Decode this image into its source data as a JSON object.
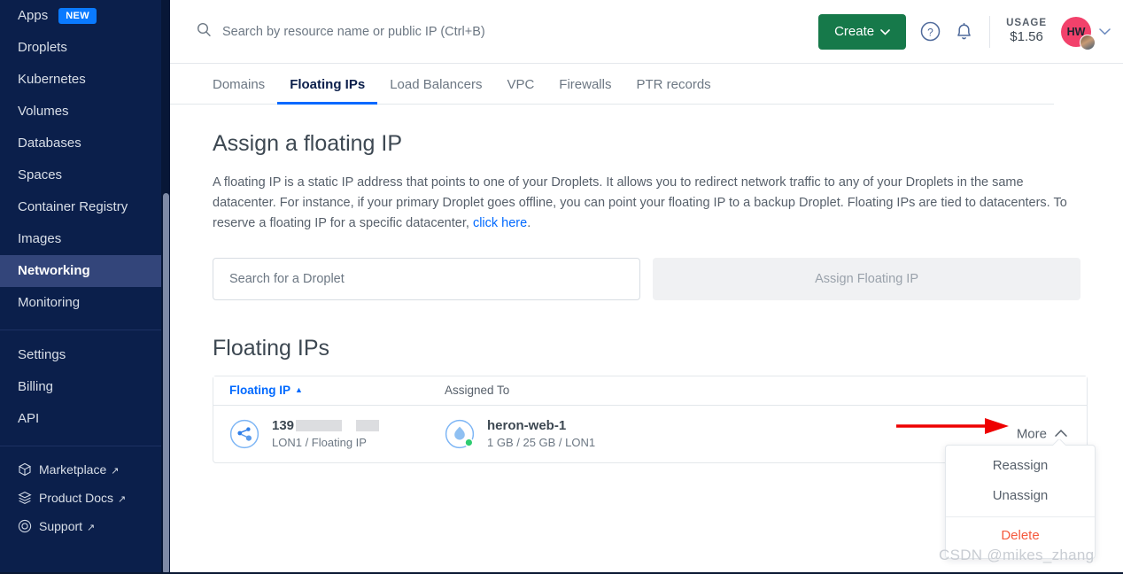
{
  "sidebar": {
    "items": [
      {
        "label": "Apps",
        "badge": "NEW",
        "active": false
      },
      {
        "label": "Droplets",
        "active": false
      },
      {
        "label": "Kubernetes",
        "active": false
      },
      {
        "label": "Volumes",
        "active": false
      },
      {
        "label": "Databases",
        "active": false
      },
      {
        "label": "Spaces",
        "active": false
      },
      {
        "label": "Container Registry",
        "active": false
      },
      {
        "label": "Images",
        "active": false
      },
      {
        "label": "Networking",
        "active": true
      },
      {
        "label": "Monitoring",
        "active": false
      }
    ],
    "account_items": [
      {
        "label": "Settings"
      },
      {
        "label": "Billing"
      },
      {
        "label": "API"
      }
    ],
    "external_items": [
      {
        "label": "Marketplace",
        "icon": "cube-icon",
        "arrow": "↗"
      },
      {
        "label": "Product Docs",
        "icon": "stack-icon",
        "arrow": "↗"
      },
      {
        "label": "Support",
        "icon": "lifering-icon",
        "arrow": "↗"
      }
    ],
    "colors": {
      "background": "#0b1f4b",
      "active_background": "#33457a",
      "badge": "#0a7aff"
    }
  },
  "header": {
    "search_placeholder": "Search by resource name or public IP (Ctrl+B)",
    "search_value": "",
    "create_label": "Create",
    "create_caret": "⌄",
    "help_icon": "help-circle-icon",
    "bell_icon": "notification-bell-icon",
    "usage_label": "USAGE",
    "usage_amount": "$1.56",
    "avatar_initials": "HW",
    "avatar_caret": "⌄",
    "colors": {
      "create_button": "#16794a",
      "avatar": "#f2416b"
    }
  },
  "tabs": [
    {
      "label": "Domains",
      "active": false
    },
    {
      "label": "Floating IPs",
      "active": true
    },
    {
      "label": "Load Balancers",
      "active": false
    },
    {
      "label": "VPC",
      "active": false
    },
    {
      "label": "Firewalls",
      "active": false
    },
    {
      "label": "PTR records",
      "active": false
    }
  ],
  "main": {
    "page_title": "Assign a floating IP",
    "description_part1": "A floating IP is a static IP address that points to one of your Droplets. It allows you to redirect network traffic to any of your Droplets in the same datacenter. For instance, if your primary Droplet goes offline, you can point your floating IP to a backup Droplet. Floating IPs are tied to datacenters. To reserve a floating IP for a specific datacenter, ",
    "description_link": "click here",
    "description_part2": ".",
    "droplet_search_placeholder": "Search for a Droplet",
    "droplet_search_value": "",
    "assign_button_label": "Assign Floating IP",
    "list_title": "Floating IPs"
  },
  "table": {
    "columns": [
      {
        "label": "Floating IP",
        "sort": "▲"
      },
      {
        "label": "Assigned To"
      }
    ],
    "rows": [
      {
        "ip_prefix": "139",
        "ip_sub": "LON1 / Floating IP",
        "droplet_name": "heron-web-1",
        "droplet_sub": "1 GB / 25 GB / LON1",
        "more_label": "More",
        "more_caret": "⌃"
      }
    ]
  },
  "more_menu": {
    "items": [
      {
        "label": "Reassign",
        "danger": false
      },
      {
        "label": "Unassign",
        "danger": false
      },
      {
        "label": "Delete",
        "danger": true
      }
    ],
    "danger_color": "#f5593d"
  },
  "annotation": {
    "arrow_color": "#ee0000"
  },
  "watermark": "CSDN @mikes_zhang"
}
